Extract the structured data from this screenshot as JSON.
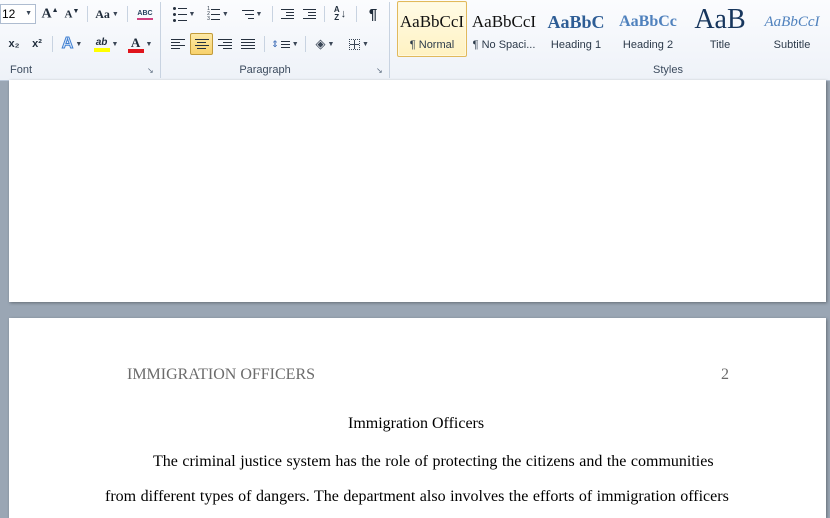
{
  "ribbon": {
    "font": {
      "size_value": "12",
      "grow_icon": "A",
      "shrink_icon": "A",
      "change_case": "Aa",
      "clear_format_icon": "ABC",
      "subscript": "x₂",
      "superscript": "x²",
      "text_effects_icon": "A",
      "highlight_icon": "ab",
      "font_color_icon": "A",
      "group_label": "Font"
    },
    "paragraph": {
      "group_label": "Paragraph",
      "pilcrow": "¶"
    },
    "styles": {
      "group_label": "Styles",
      "items": [
        {
          "sample": "AaBbCcI",
          "name": "¶ Normal"
        },
        {
          "sample": "AaBbCcI",
          "name": "¶ No Spaci..."
        },
        {
          "sample": "AaBbC",
          "name": "Heading 1"
        },
        {
          "sample": "AaBbCc",
          "name": "Heading 2"
        },
        {
          "sample": "AaB",
          "name": "Title"
        },
        {
          "sample": "AaBbCcI",
          "name": "Subtitle"
        }
      ]
    }
  },
  "document": {
    "header_text": "IMMIGRATION OFFICERS",
    "page_number": "2",
    "title": "Immigration Officers",
    "line1": "The criminal justice system has the role of protecting the citizens and the communities",
    "line2": "from different types of dangers. The department also involves the efforts of immigration  officers"
  },
  "colors": {
    "highlight": "#ffff00",
    "font_color": "#e0141c",
    "heading_blue": "#2e5d95",
    "header_gray": "#6b6b6b"
  }
}
